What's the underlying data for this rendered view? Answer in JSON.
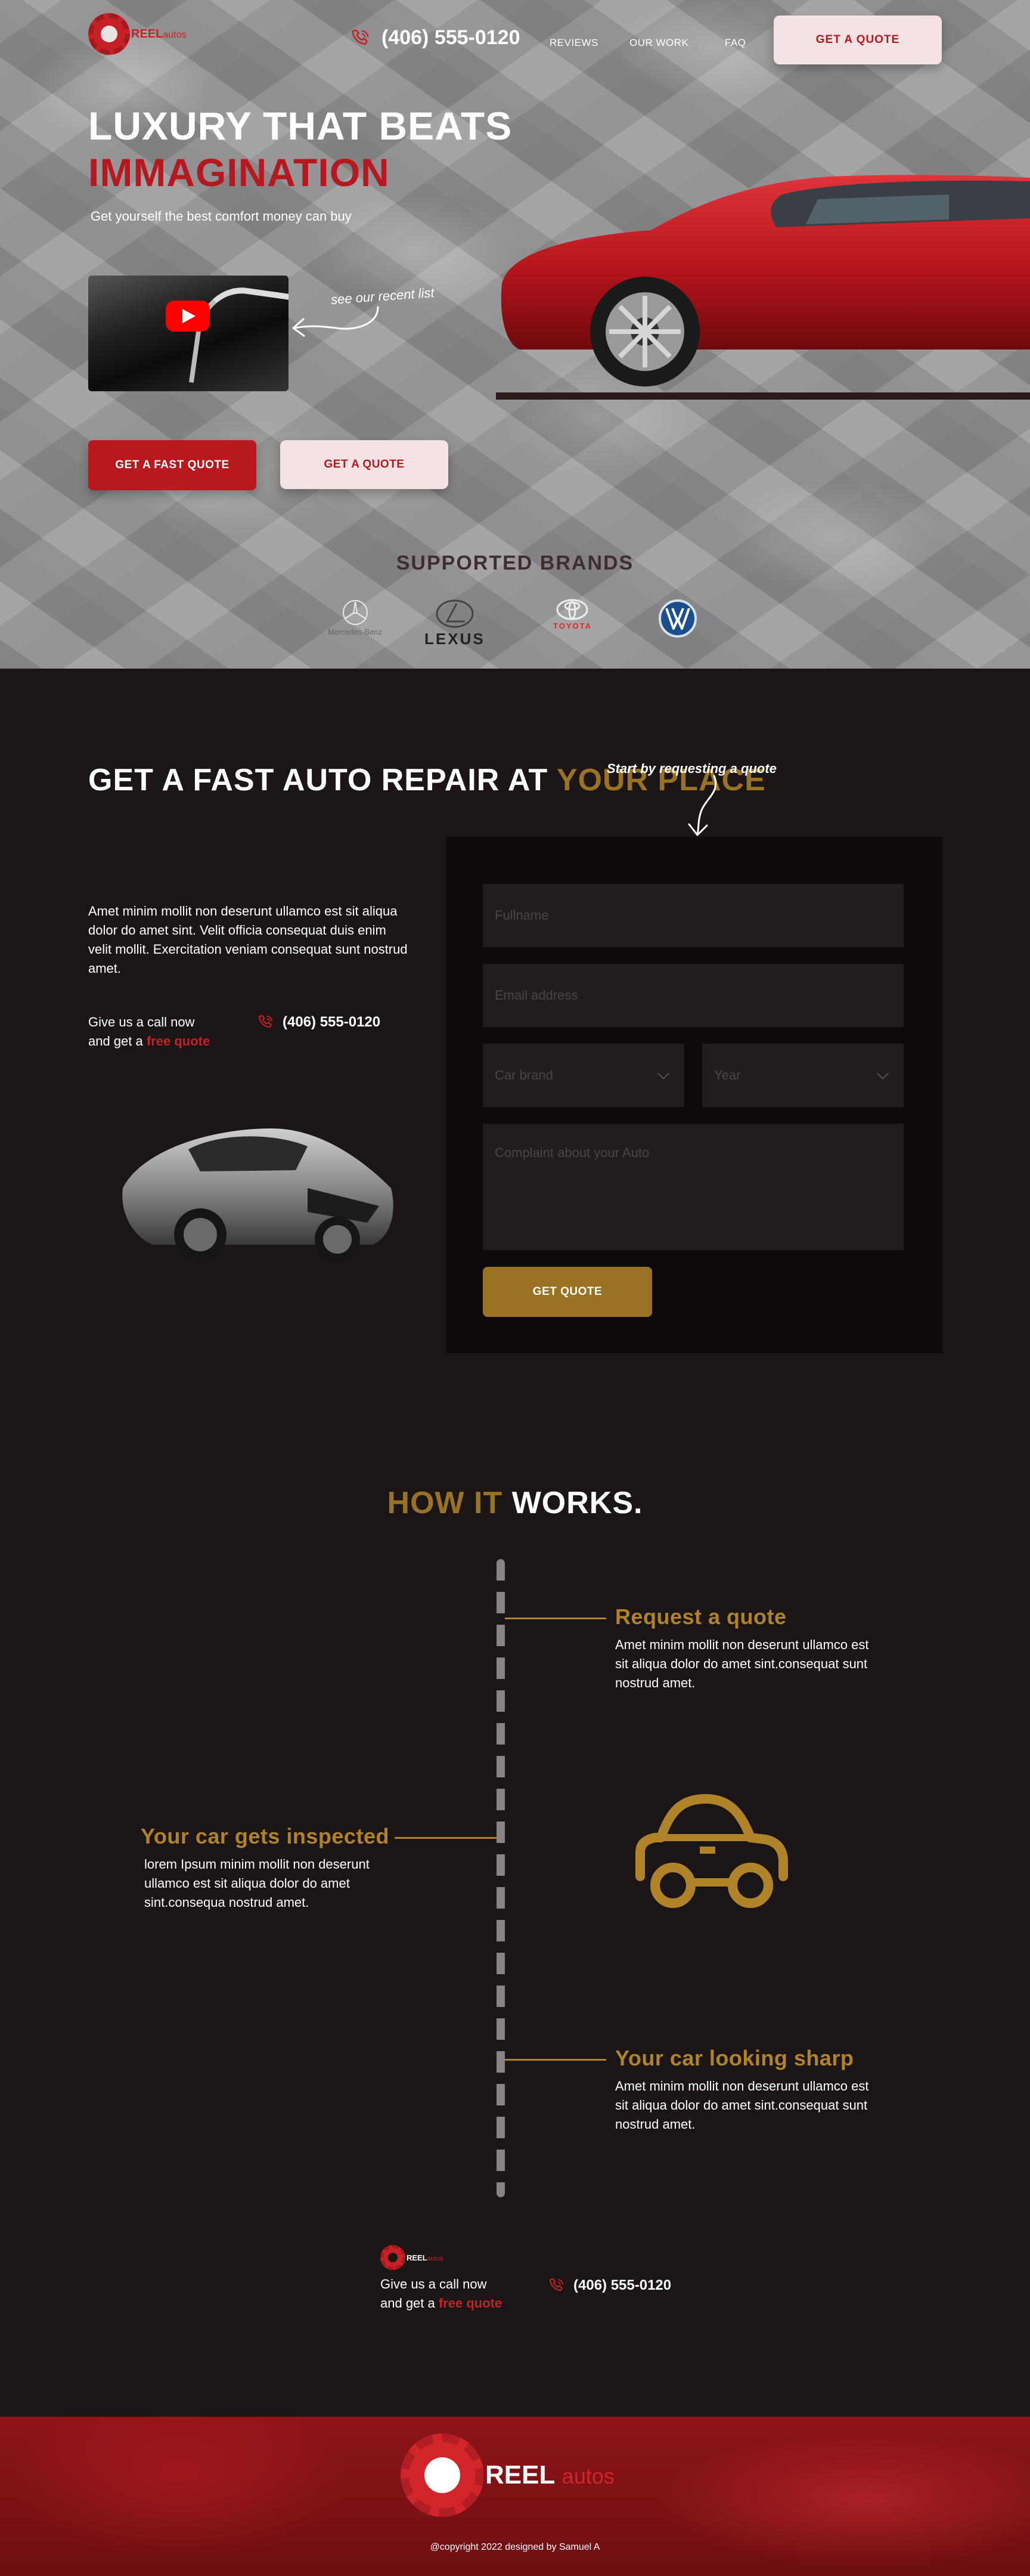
{
  "brand": {
    "name": "REEL",
    "suffix": "autos"
  },
  "nav": {
    "phone": "(406) 555-0120",
    "links": [
      "REVIEWS",
      "OUR WORK",
      "FAQ"
    ],
    "cta": "GET A QUOTE"
  },
  "hero": {
    "headline_line1": "LUXURY THAT BEATS",
    "headline_line2": "IMMAGINATION",
    "subtitle": "Get yourself the best comfort money can buy",
    "see_recent": "see our recent list",
    "primary_button": "GET A FAST QUOTE",
    "secondary_button": "GET A QUOTE"
  },
  "brands": {
    "title": "SUPPORTED BRANDS",
    "items": [
      "Mercedes-Benz",
      "LEXUS",
      "TOYOTA",
      "VW"
    ]
  },
  "repair": {
    "heading_part1": "GET  A FAST AUTO REPAIR AT ",
    "heading_part2": "YOUR PLACE",
    "paragraph": "Amet minim mollit non deserunt ullamco est sit aliqua dolor do amet sint. Velit officia consequat duis enim velit mollit. Exercitation veniam consequat sunt nostrud amet.",
    "call_line1": "Give us a call now",
    "call_line2_prefix": "and get a ",
    "call_line2_highlight": "free quote",
    "phone": "(406) 555-0120"
  },
  "form": {
    "intro": "Start by requesting a quote",
    "fullname_placeholder": "Fullname",
    "email_placeholder": "Email address",
    "car_brand_placeholder": "Car brand",
    "year_placeholder": "Year",
    "complaint_placeholder": "Complaint about your Auto",
    "submit": "GET QUOTE"
  },
  "how": {
    "title_part1": "HOW IT",
    "title_part2": " WORKS.",
    "steps": [
      {
        "title": "Request a quote",
        "text": "Amet minim mollit non deserunt ullamco est sit aliqua dolor do amet sint.consequat sunt nostrud amet."
      },
      {
        "title": "Your car gets inspected",
        "text": "lorem Ipsum minim mollit non deserunt ullamco est sit aliqua dolor do amet sint.consequa nostrud amet."
      },
      {
        "title": "Your car looking sharp",
        "text": "Amet minim mollit non deserunt ullamco est sit aliqua dolor do amet sint.consequat sunt nostrud amet."
      }
    ]
  },
  "footer": {
    "call_line1": "Give us a call now",
    "call_line2_prefix": "and get a ",
    "call_line2_highlight": "free quote",
    "phone": "(406) 555-0120",
    "copyright": "@copyright 2022 designed by Samuel A"
  },
  "colors": {
    "brand_red": "#c62126",
    "gold": "#9a7224",
    "dark_bg": "#1b1516",
    "soft_pink": "#f4e3e4"
  }
}
